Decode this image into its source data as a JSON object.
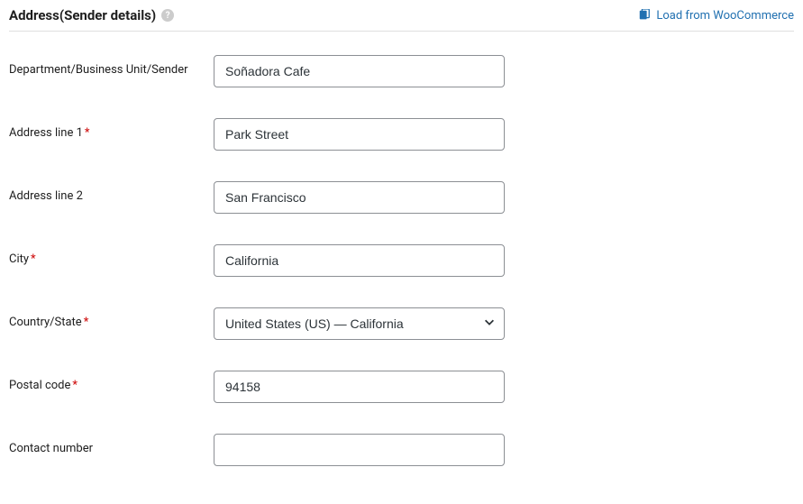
{
  "section": {
    "title": "Address(Sender details)",
    "load_link_label": "Load from WooCommerce"
  },
  "fields": {
    "department": {
      "label": "Department/Business Unit/Sender",
      "value": "Soñadora Cafe",
      "required": false
    },
    "address_line_1": {
      "label": "Address line 1",
      "value": "Park Street",
      "required": true
    },
    "address_line_2": {
      "label": "Address line 2",
      "value": "San Francisco",
      "required": false
    },
    "city": {
      "label": "City",
      "value": "California",
      "required": true
    },
    "country_state": {
      "label": "Country/State",
      "value": "United States (US) — California",
      "required": true
    },
    "postal_code": {
      "label": "Postal code",
      "value": "94158",
      "required": true
    },
    "contact_number": {
      "label": "Contact number",
      "value": "",
      "required": false
    }
  }
}
